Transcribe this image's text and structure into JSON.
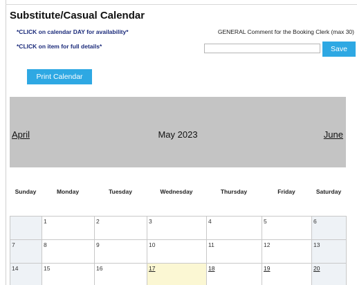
{
  "page": {
    "title": "Substitute/Casual Calendar",
    "instruction_day": "*CLICK on calendar DAY for availability*",
    "instruction_item": "*CLICK on item for full details*"
  },
  "comment": {
    "label": "GENERAL Comment for the Booking Clerk (max 30)",
    "value": "",
    "save_label": "Save"
  },
  "print_label": "Print Calendar",
  "calendar": {
    "prev_month": "April",
    "month_title": "May 2023",
    "next_month": "June",
    "days_of_week": [
      "Sunday",
      "Monday",
      "Tuesday",
      "Wednesday",
      "Thursday",
      "Friday",
      "Saturday"
    ],
    "weeks": [
      [
        {
          "day": "",
          "weekend": true
        },
        {
          "day": "1"
        },
        {
          "day": "2"
        },
        {
          "day": "3"
        },
        {
          "day": "4"
        },
        {
          "day": "5"
        },
        {
          "day": "6",
          "weekend": true
        }
      ],
      [
        {
          "day": "7",
          "weekend": true
        },
        {
          "day": "8"
        },
        {
          "day": "9"
        },
        {
          "day": "10"
        },
        {
          "day": "11"
        },
        {
          "day": "12"
        },
        {
          "day": "13",
          "weekend": true
        }
      ],
      [
        {
          "day": "14",
          "weekend": true
        },
        {
          "day": "15"
        },
        {
          "day": "16"
        },
        {
          "day": "17",
          "link": true,
          "today": true
        },
        {
          "day": "18",
          "link": true
        },
        {
          "day": "19",
          "link": true
        },
        {
          "day": "20",
          "link": true,
          "weekend": true
        }
      ]
    ],
    "colors": {
      "header_bg": "#c4c4c4",
      "button_bg": "#2ea8e3",
      "today_bg": "#fbf7d3",
      "weekend_bg": "#eef2f6"
    }
  }
}
